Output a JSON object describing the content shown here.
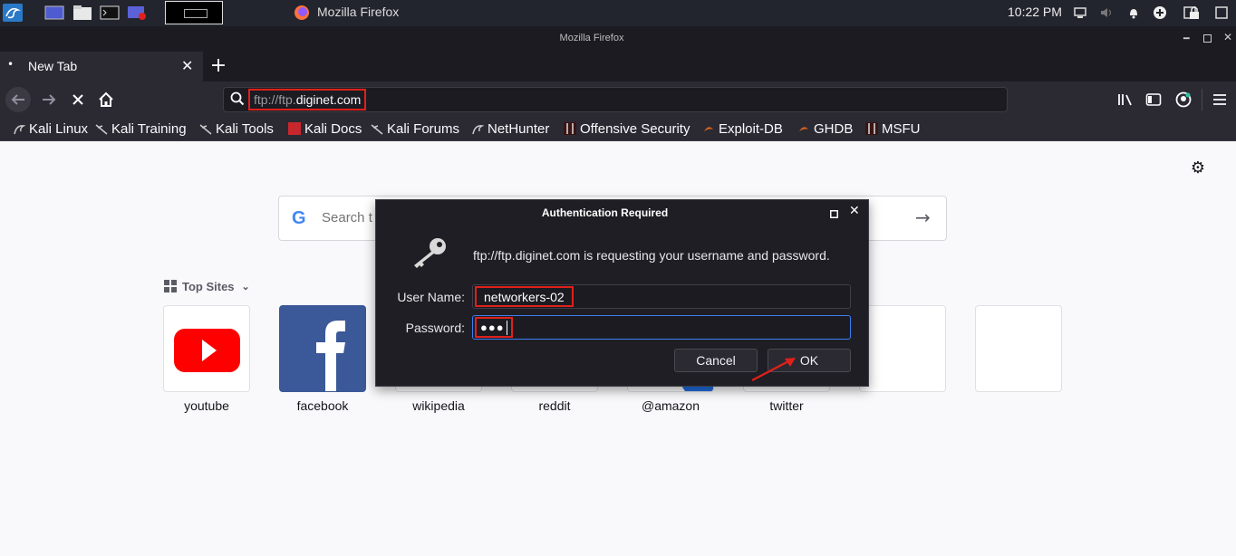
{
  "panel": {
    "app_title": "Mozilla Firefox",
    "clock": "10:22 PM"
  },
  "window": {
    "title": "Mozilla Firefox"
  },
  "tab": {
    "label": "New Tab"
  },
  "urlbar": {
    "url_prefix": "ftp://ftp.",
    "url_domain": "diginet.com"
  },
  "bookmarks": [
    {
      "label": "Kali Linux"
    },
    {
      "label": "Kali Training"
    },
    {
      "label": "Kali Tools"
    },
    {
      "label": "Kali Docs"
    },
    {
      "label": "Kali Forums"
    },
    {
      "label": "NetHunter"
    },
    {
      "label": "Offensive Security"
    },
    {
      "label": "Exploit-DB"
    },
    {
      "label": "GHDB"
    },
    {
      "label": "MSFU"
    }
  ],
  "search": {
    "placeholder": "Search t"
  },
  "top_sites": {
    "heading": "Top Sites",
    "tiles": [
      {
        "label": "youtube"
      },
      {
        "label": "facebook"
      },
      {
        "label": "wikipedia"
      },
      {
        "label": "reddit"
      },
      {
        "label": "@amazon"
      },
      {
        "label": "twitter"
      }
    ]
  },
  "dialog": {
    "title": "Authentication Required",
    "message": "ftp://ftp.diginet.com is requesting your username and password.",
    "username_label": "User Name:",
    "username_value": "networkers-02",
    "password_label": "Password:",
    "password_value": "●●●",
    "cancel_label": "Cancel",
    "ok_label": "OK"
  },
  "colors": {
    "highlight": "#e0201b",
    "dialog_bg": "#1f1e25",
    "toolbar_bg": "#2b2a33"
  }
}
